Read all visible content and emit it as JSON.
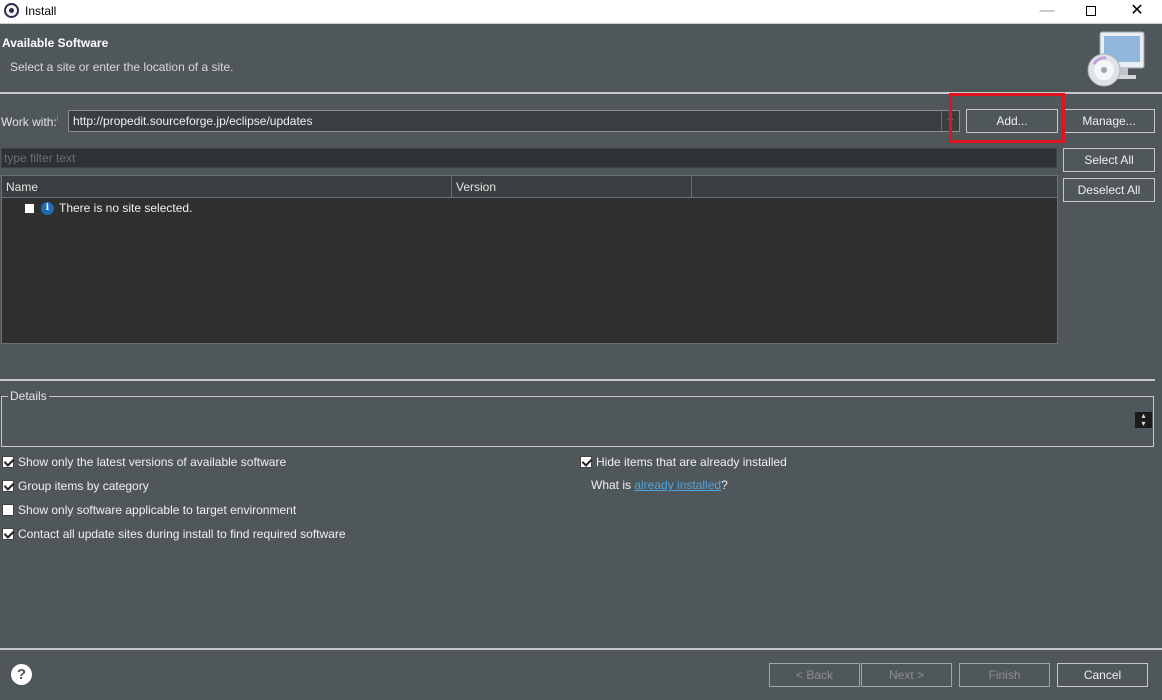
{
  "window": {
    "title": "Install",
    "controls": {
      "minimize": "—",
      "close": "✕"
    }
  },
  "header": {
    "title": "Available Software",
    "subtitle": "Select a site or enter the location of a site.",
    "icon": "install-cd-monitor-icon"
  },
  "work_with": {
    "label": "Work with:",
    "value": "http://propedit.sourceforge.jp/eclipse/updates",
    "add_button": "Add...",
    "manage_button": "Manage..."
  },
  "filter": {
    "placeholder": "type filter text"
  },
  "selection": {
    "select_all": "Select All",
    "deselect_all": "Deselect All"
  },
  "table": {
    "columns": [
      "Name",
      "Version"
    ],
    "rows": [
      {
        "text": "There is no site selected.",
        "checked": false,
        "icon": "info-icon"
      }
    ]
  },
  "details": {
    "legend": "Details"
  },
  "options": {
    "show_latest": {
      "label": "Show only the latest versions of available software",
      "checked": true
    },
    "group_by_category": {
      "label": "Group items by category",
      "checked": true
    },
    "applicable_only": {
      "label": "Show only software applicable to target environment",
      "checked": false
    },
    "contact_all_sites": {
      "label": "Contact all update sites during install to find required software",
      "checked": true
    },
    "hide_installed": {
      "label": "Hide items that are already installed",
      "checked": true
    },
    "what_is_prefix": "What is ",
    "what_is_link": "already installed",
    "what_is_suffix": "?"
  },
  "footer": {
    "help_icon": "?",
    "back": "< Back",
    "next": "Next >",
    "finish": "Finish",
    "cancel": "Cancel"
  },
  "colors": {
    "background": "#50575b",
    "highlight": "#e0141e",
    "link": "#4fa3e0"
  }
}
